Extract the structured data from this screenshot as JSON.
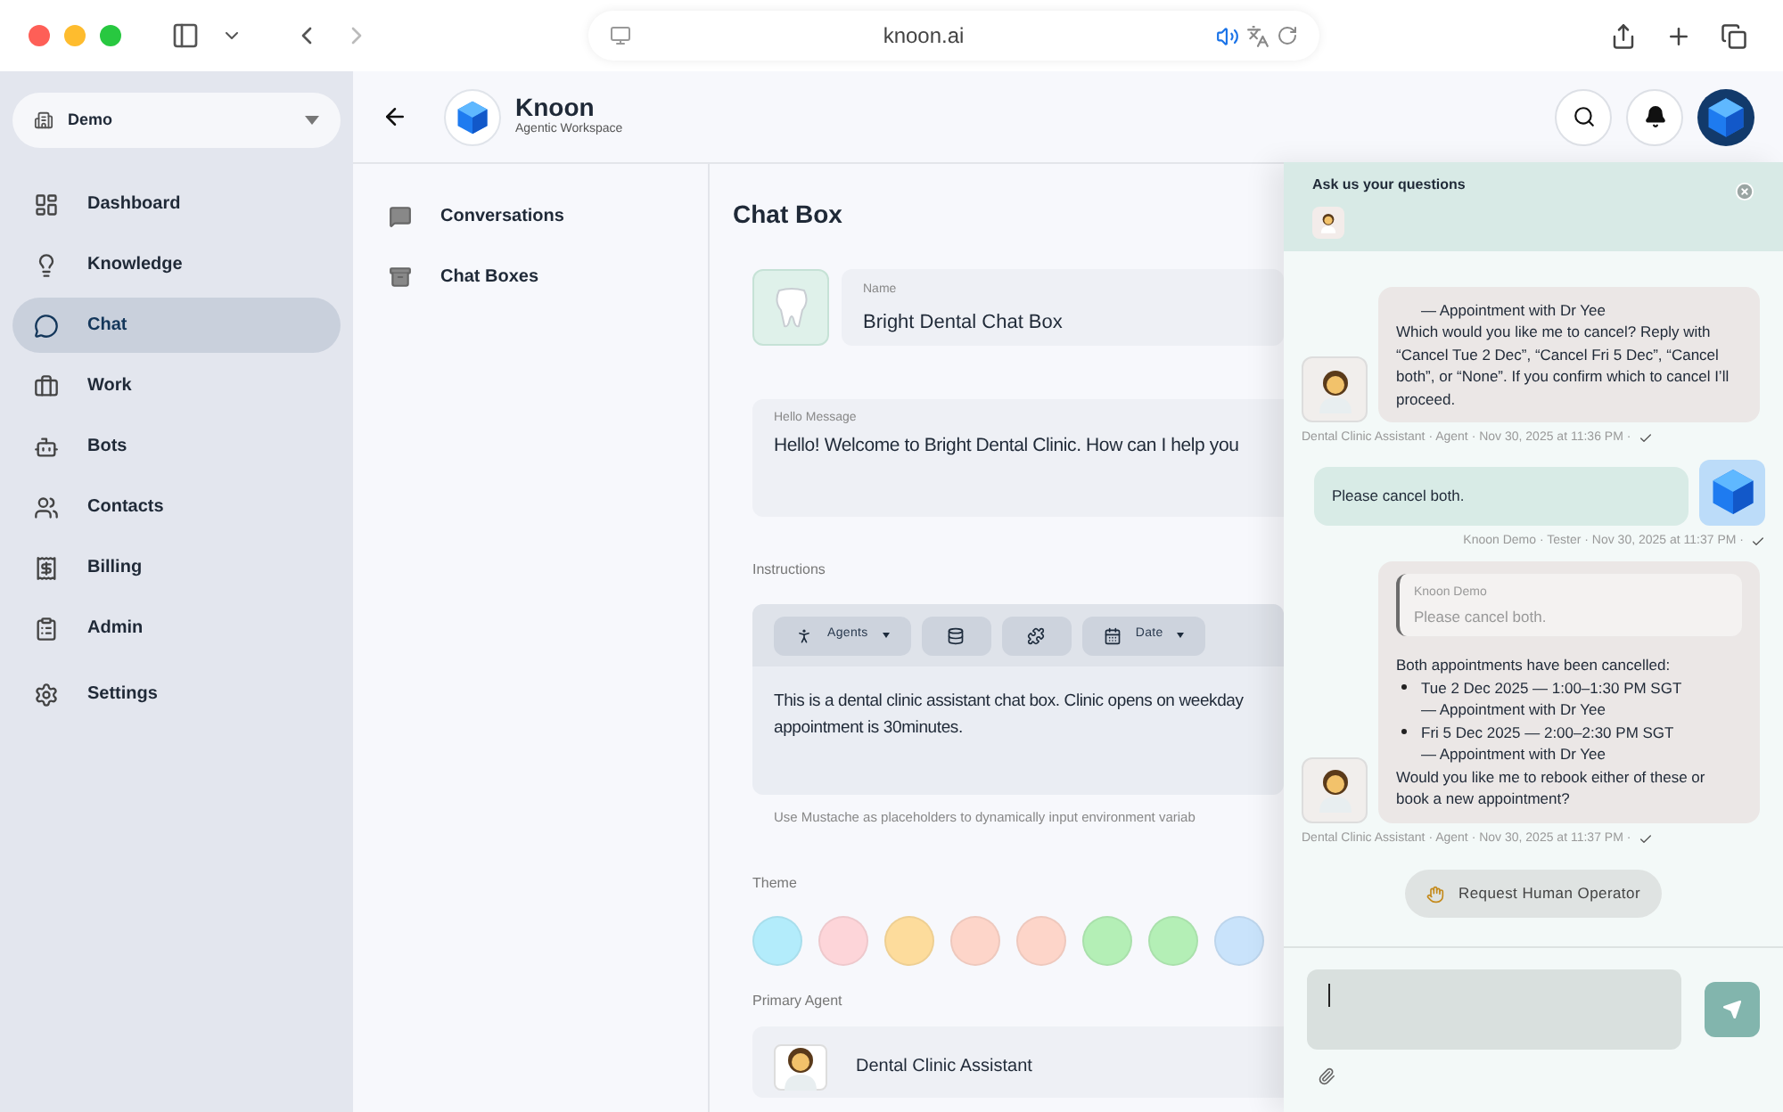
{
  "browser": {
    "url": "knoon.ai"
  },
  "sidebar": {
    "workspace": "Demo",
    "items": [
      {
        "label": "Dashboard",
        "selected": false
      },
      {
        "label": "Knowledge",
        "selected": false
      },
      {
        "label": "Chat",
        "selected": true
      },
      {
        "label": "Work",
        "selected": false
      },
      {
        "label": "Bots",
        "selected": false
      },
      {
        "label": "Contacts",
        "selected": false
      },
      {
        "label": "Billing",
        "selected": false
      },
      {
        "label": "Admin",
        "selected": false
      },
      {
        "label": "Settings",
        "selected": false
      }
    ]
  },
  "header": {
    "title": "Knoon",
    "subtitle": "Agentic Workspace"
  },
  "subnav": [
    "Conversations",
    "Chat Boxes"
  ],
  "page": {
    "title": "Chat Box",
    "name_label": "Name",
    "name_value": "Bright Dental Chat Box",
    "hello_label": "Hello Message",
    "hello_value": "Hello! Welcome to Bright Dental Clinic. How can I help you",
    "instructions_label": "Instructions",
    "toolbar": [
      {
        "kind": "dropdown",
        "label": "Agents"
      },
      {
        "kind": "icon"
      },
      {
        "kind": "icon"
      },
      {
        "kind": "dropdown",
        "label": "Date"
      }
    ],
    "instructions_lines": [
      "This is a dental clinic assistant chat box. Clinic opens on weekday",
      "appointment is 30minutes."
    ],
    "hint": "Use Mustache as placeholders to dynamically input environment variab",
    "theme_label": "Theme",
    "theme_colors": [
      {
        "color": "#b3ecfb"
      },
      {
        "color": "#fdd5d9"
      },
      {
        "color": "#fddc9c"
      },
      {
        "color": "#fdd5c9"
      },
      {
        "color": "#fdd5c9"
      },
      {
        "color": "#b4efb6"
      },
      {
        "color": "#b4efb6"
      },
      {
        "color": "#c9e3fb"
      }
    ],
    "primary_agent_label": "Primary Agent",
    "primary_agent_value": "Dental Clinic Assistant"
  },
  "chat": {
    "title": "Ask us your questions",
    "messages": [
      {
        "kind": "agent",
        "blocks": [
          {
            "kind": "sub",
            "text": "— Appointment with Dr Yee"
          },
          {
            "kind": "text",
            "text": "Which would you like me to cancel? Reply with “Cancel Tue 2 Dec”, “Cancel Fri 5 Dec”, “Cancel both”, or “None”. If you confirm which to cancel I’ll proceed."
          }
        ],
        "meta": "Dental Clinic Assistant · Agent · Nov 30, 2025 at 11:36 PM ·"
      },
      {
        "kind": "user",
        "blocks": [
          {
            "kind": "text",
            "text": "Please cancel both."
          }
        ],
        "meta": "Knoon Demo · Tester · Nov 30, 2025 at 11:37 PM ·"
      },
      {
        "kind": "agent",
        "quote": {
          "author": "Knoon Demo",
          "text": "Please cancel both."
        },
        "blocks": [
          {
            "kind": "text",
            "text": "Both appointments have been cancelled:"
          },
          {
            "kind": "bullet",
            "text": "Tue 2 Dec 2025 — 1:00–1:30 PM SGT"
          },
          {
            "kind": "sub",
            "text": "— Appointment with Dr Yee"
          },
          {
            "kind": "bullet",
            "text": "Fri 5 Dec 2025 — 2:00–2:30 PM SGT"
          },
          {
            "kind": "sub",
            "text": "— Appointment with Dr Yee"
          },
          {
            "kind": "text",
            "text": "Would you like me to rebook either of these or book a new appointment?"
          }
        ],
        "meta": "Dental Clinic Assistant · Agent · Nov 30, 2025 at 11:37 PM ·"
      }
    ],
    "action": "Request Human Operator"
  }
}
